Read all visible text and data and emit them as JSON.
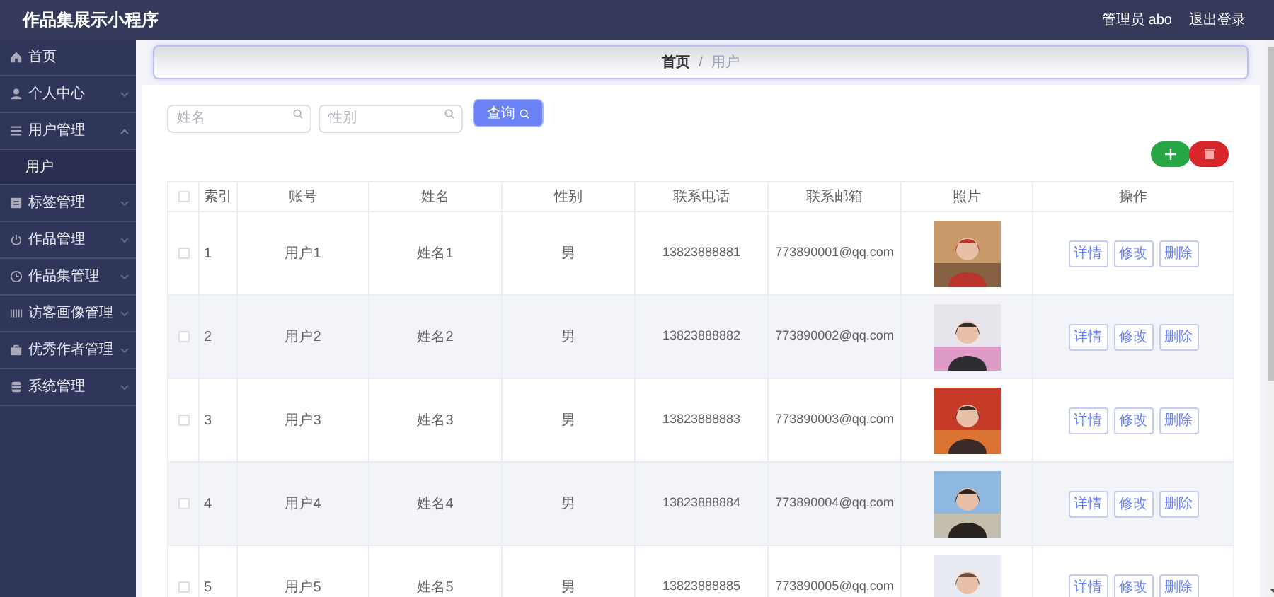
{
  "header": {
    "title": "作品集展示小程序",
    "user": "管理员 abo",
    "logout": "退出登录"
  },
  "sidebar": {
    "items": [
      {
        "label": "首页"
      },
      {
        "label": "个人中心",
        "expanded": false
      },
      {
        "label": "用户管理",
        "expanded": true,
        "children": [
          {
            "label": "用户",
            "selected": true
          }
        ]
      },
      {
        "label": "标签管理",
        "expanded": false
      },
      {
        "label": "作品管理",
        "expanded": false
      },
      {
        "label": "作品集管理",
        "expanded": false
      },
      {
        "label": "访客画像管理",
        "expanded": false
      },
      {
        "label": "优秀作者管理",
        "expanded": false
      },
      {
        "label": "系统管理",
        "expanded": false
      }
    ]
  },
  "breadcrumb": {
    "items": [
      "首页",
      "用户"
    ],
    "separator": "/"
  },
  "search": {
    "fields": [
      {
        "placeholder": "姓名"
      },
      {
        "placeholder": "性别"
      }
    ],
    "button": "查询"
  },
  "table": {
    "select_all": {
      "checked": false
    },
    "columns": [
      "索引",
      "账号",
      "姓名",
      "性别",
      "联系电话",
      "联系邮箱",
      "照片",
      "操作"
    ],
    "rows": [
      {
        "checked": false,
        "index": "1",
        "account": "用户1",
        "name": "姓名1",
        "gender": "男",
        "phone": "13823888881",
        "email": "773890001@qq.com",
        "actions": [
          "详情",
          "修改",
          "删除"
        ]
      },
      {
        "checked": false,
        "index": "2",
        "account": "用户2",
        "name": "姓名2",
        "gender": "男",
        "phone": "13823888882",
        "email": "773890002@qq.com",
        "actions": [
          "详情",
          "修改",
          "删除"
        ]
      },
      {
        "checked": false,
        "index": "3",
        "account": "用户3",
        "name": "姓名3",
        "gender": "男",
        "phone": "13823888883",
        "email": "773890003@qq.com",
        "actions": [
          "详情",
          "修改",
          "删除"
        ]
      },
      {
        "checked": false,
        "index": "4",
        "account": "用户4",
        "name": "姓名4",
        "gender": "男",
        "phone": "13823888884",
        "email": "773890004@qq.com",
        "actions": [
          "详情",
          "修改",
          "删除"
        ]
      },
      {
        "checked": false,
        "index": "5",
        "account": "用户5",
        "name": "姓名5",
        "gender": "男",
        "phone": "13823888885",
        "email": "773890005@qq.com",
        "actions": [
          "详情",
          "修改",
          "删除"
        ]
      }
    ]
  }
}
